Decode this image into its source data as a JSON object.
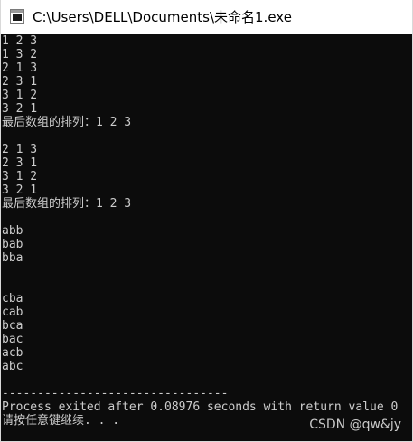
{
  "window": {
    "title": "C:\\Users\\DELL\\Documents\\未命名1.exe",
    "icon": "console-app-icon"
  },
  "console": {
    "lines": [
      "1 2 3",
      "1 3 2",
      "2 1 3",
      "2 3 1",
      "3 1 2",
      "3 2 1",
      "最后数组的排列：1 2 3",
      "",
      "2 1 3",
      "2 3 1",
      "3 1 2",
      "3 2 1",
      "最后数组的排列：1 2 3",
      "",
      "abb",
      "bab",
      "bba",
      "",
      "",
      "cba",
      "cab",
      "bca",
      "bac",
      "acb",
      "abc",
      "",
      "--------------------------------",
      "Process exited after 0.08976 seconds with return value 0",
      "请按任意键继续. . ."
    ],
    "text_color": "#cccccc",
    "background": "#0c0c0c"
  },
  "watermark": {
    "text": "CSDN @qw&jy"
  }
}
